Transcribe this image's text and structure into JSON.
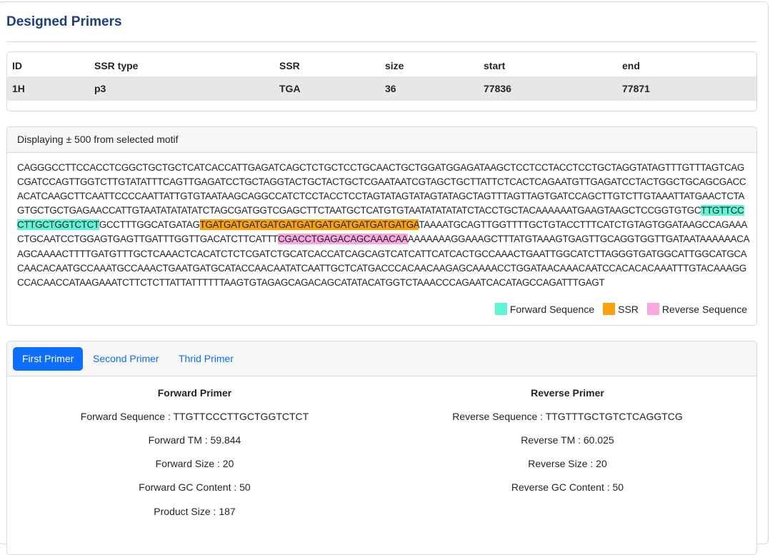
{
  "page_title": "Designed Primers",
  "table": {
    "headers": [
      "ID",
      "SSR type",
      "SSR",
      "size",
      "start",
      "end"
    ],
    "row": [
      "1H",
      "p3",
      "TGA",
      "36",
      "77836",
      "77871"
    ]
  },
  "sequence": {
    "header": "Displaying ± 500 from selected motif",
    "pre": "CAGGGCCTTCCACCTCGGCTGCTGCTCATCACCATTGAGATCAGCTCTGCTCCTGCAACTGCTGGATGGAGATAAGCTCCTCCTACCTCCTGCTAGGTATAGTTTGTTTAGTCAGCGATCCAGTTGGTCTTGTATATTTCAGTTGAGATCCTGCTAGGTACTGCTACTGCTCGAATAATCGTAGCTGCTTATTCTCACTCAGAATGTTGAGATCCTACTGGCTGCAGCGACCACATCAAGCTTCAATTCCCCAATTATTGTGTAATAAGCAGGCCATCTCCTACCTCCTAGTATAGTATAGTATAGCTAGTTTAGTTAGTGATCCAGCTTGTCTTGTAAATTATGAACTCTAGTGCTGCTGAGAACCATTGTAATATATATATCTAGCGATGGTCGAGCTTCTAATGCTCATGTGTAATATATATATCTACCTGCTACAAAAAATGAAGTAAGCTCCGGTGTGC",
    "forward": "TTGTTCCCTTGCTGGTCTCT",
    "mid1": "GCCTTTGGCATGATAG",
    "ssr": "TGATGATGATGATGATGATGATGATGATGATGATGA",
    "mid2": "TAAAATGCAGTTGGTTTTGCTGTACCTTTCATCTGTAGTGGATAAGCCAGAAACTGCAATCCTGGAGTGAGTTGATTTGGTTGACATCTTCATTT",
    "reverse": "CGACCTGAGACAGCAAACAA",
    "post": "AAAAAAAGGAAAGCTTTATGTAAAGTGAGTTGCAGGTGGTTGATAATAAAAAACAAGCAAAACTTTTGATGTTTGCTCAAACTCACATCTCTCGATCTGCATCACCATCAGCAGTCATCATTCATCACTGCCAAACTGAATTGGCATCTTAGGGTGATGGCATTGGCATGCACAACACAATGCCAAATGCCAAACTGAATGATGCATACCAACAATATCAATTGCTCATGACCCACAACAAGAGCAAAACCTGGATAACAAACAATCCACACACAAATTTGTACAAAGGCCACAACCATAAGAAATCTTCTCTTATTATTTTTTAAGTGTAGAGCAGACAGCATATACATGGTCTAAACCCAGAATCACATAGCCAGATTTGAGT"
  },
  "legend": {
    "forward": "Forward Sequence",
    "ssr": "SSR",
    "reverse": "Reverse Sequence",
    "colors": {
      "forward": "#5ff5d4",
      "ssr": "#f9a20b",
      "reverse": "#f8a8dc"
    }
  },
  "tabs": [
    "First Primer",
    "Second Primer",
    "Thrid Primer"
  ],
  "forward_primer": {
    "heading": "Forward Primer",
    "sequence": "Forward Sequence : TTGTTCCCTTGCTGGTCTCT",
    "tm": "Forward TM : 59.844",
    "size": "Forward Size : 20",
    "gc": "Forward GC Content : 50",
    "product": "Product Size : 187"
  },
  "reverse_primer": {
    "heading": "Reverse Primer",
    "sequence": "Reverse Sequence : TTGTTTGCTGTCTCAGGTCG",
    "tm": "Reverse TM : 60.025",
    "size": "Reverse Size : 20",
    "gc": "Reverse GC Content : 50"
  }
}
